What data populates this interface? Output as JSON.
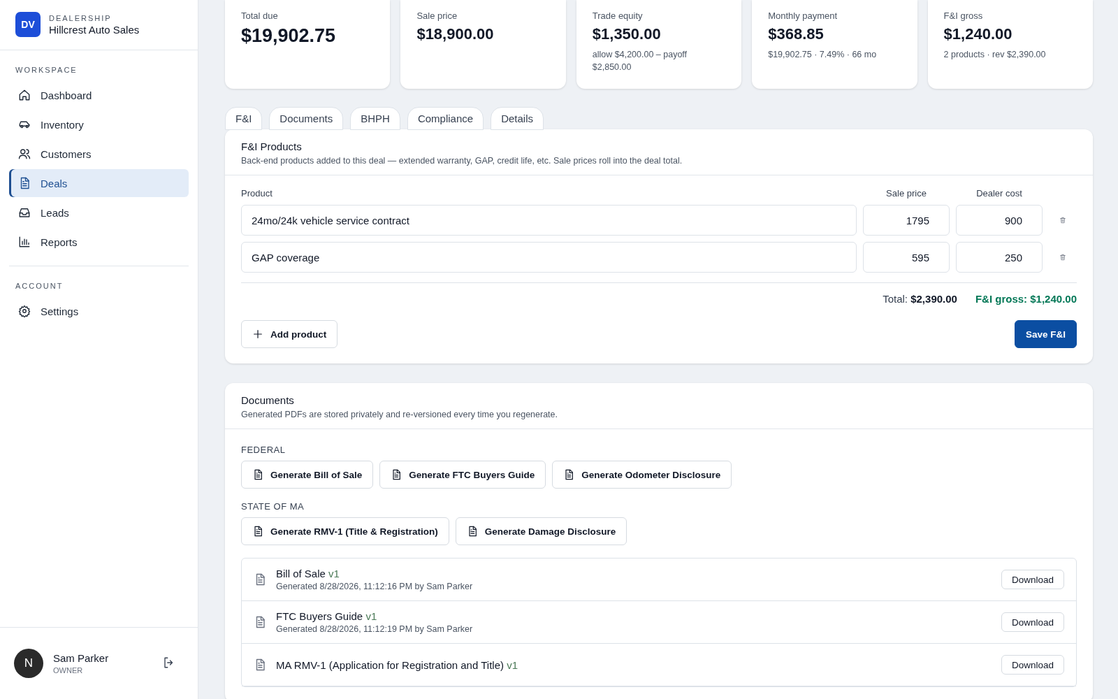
{
  "brand": {
    "initials": "DV",
    "eyebrow": "DEALERSHIP",
    "name": "Hillcrest Auto Sales"
  },
  "sidebar": {
    "sections": [
      {
        "heading": "WORKSPACE",
        "items": [
          {
            "label": "Dashboard",
            "kind": "home",
            "selected": false
          },
          {
            "label": "Inventory",
            "kind": "car",
            "selected": false
          },
          {
            "label": "Customers",
            "kind": "users",
            "selected": false
          },
          {
            "label": "Deals",
            "kind": "file",
            "selected": true
          },
          {
            "label": "Leads",
            "kind": "inbox",
            "selected": false
          },
          {
            "label": "Reports",
            "kind": "chart",
            "selected": false
          }
        ]
      },
      {
        "heading": "ACCOUNT",
        "items": [
          {
            "label": "Settings",
            "kind": "gear",
            "selected": false
          }
        ]
      }
    ]
  },
  "user": {
    "initial": "N",
    "name": "Sam Parker",
    "role": "OWNER"
  },
  "stats": [
    {
      "kind": "primary",
      "label": "Total due",
      "value": "$19,902.75"
    },
    {
      "kind": "standard",
      "label": "Sale price",
      "value": "$18,900.00"
    },
    {
      "kind": "standard",
      "label": "Trade equity",
      "value": "$1,350.00",
      "note": "allow $4,200.00 – payoff $2,850.00"
    },
    {
      "kind": "standard",
      "label": "Monthly payment",
      "value": "$368.85",
      "note": "$19,902.75 · 7.49% · 66 mo"
    },
    {
      "kind": "standard",
      "label": "F&I gross",
      "value": "$1,240.00",
      "note": "2 products · rev $2,390.00"
    }
  ],
  "tabs": [
    {
      "label": "F&I",
      "selected": false
    },
    {
      "label": "Documents",
      "selected": false
    },
    {
      "label": "BHPH",
      "selected": false
    },
    {
      "label": "Compliance",
      "selected": false
    },
    {
      "label": "Details",
      "selected": false
    }
  ],
  "fi": {
    "title": "F&I Products",
    "description": "Back-end products added to this deal — extended warranty, GAP, credit life, etc. Sale prices roll into the deal total.",
    "columns": [
      "Product",
      "Sale price",
      "Dealer cost"
    ],
    "rows": [
      {
        "product": "24mo/24k vehicle service contract",
        "sale_price": "1795",
        "dealer_cost": "900"
      },
      {
        "product": "GAP coverage",
        "sale_price": "595",
        "dealer_cost": "250"
      }
    ],
    "total_label": "Total:",
    "total": "$2,390.00",
    "gross": "F&I gross: $1,240.00",
    "add_button": "Add product",
    "save_button": "Save F&I"
  },
  "documents": {
    "title": "Documents",
    "description": "Generated PDFs are stored privately and re-versioned every time you regenerate.",
    "groups": [
      {
        "heading": "FEDERAL",
        "buttons": [
          "Generate Bill of Sale",
          "Generate FTC Buyers Guide",
          "Generate Odometer Disclosure"
        ]
      },
      {
        "heading": "STATE OF MA",
        "buttons": [
          "Generate RMV-1 (Title & Registration)",
          "Generate Damage Disclosure"
        ]
      }
    ],
    "files": [
      {
        "name": "Bill of Sale",
        "version": "v1",
        "meta": "Generated 8/28/2026, 11:12:16 PM by Sam Parker",
        "action": "Download"
      },
      {
        "name": "FTC Buyers Guide",
        "version": "v1",
        "meta": "Generated 8/28/2026, 11:12:19 PM by Sam Parker",
        "action": "Download"
      },
      {
        "name": "MA RMV-1 (Application for Registration and Title)",
        "version": "v1",
        "action": "Download"
      }
    ]
  }
}
